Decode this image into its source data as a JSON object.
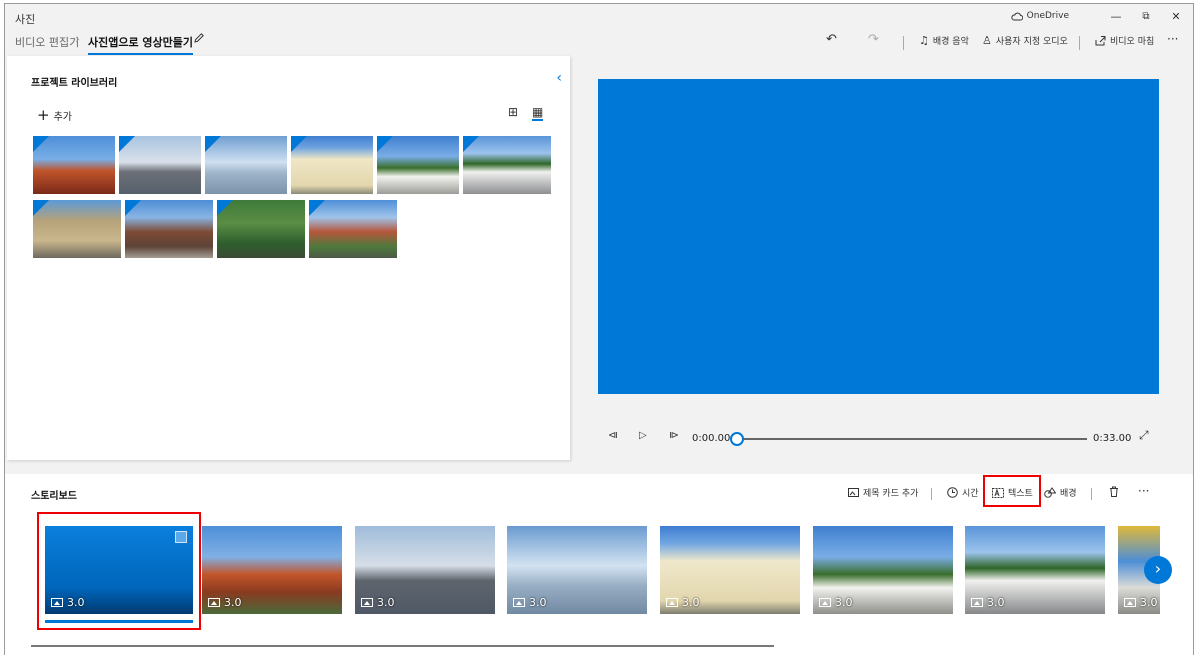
{
  "titlebar": {
    "app_title": "사진",
    "onedrive_label": "OneDrive",
    "minimize": "—",
    "maximize": "⧉",
    "close": "✕"
  },
  "breadcrumb": {
    "prev": "비디오 편집기",
    "current": "사진앱으로 영상만들기"
  },
  "toolbar": {
    "undo": "↶",
    "redo": "↷",
    "bg_music": "배경 음악",
    "custom_audio": "사용자 지정 오디오",
    "finish_video": "비디오 마침",
    "more": "···"
  },
  "library": {
    "title": "프로젝트 라이브러리",
    "add_label": "추가",
    "thumbnails": [
      {
        "name": "temple-roof-dragon"
      },
      {
        "name": "jetty-sunset"
      },
      {
        "name": "sea-clouds"
      },
      {
        "name": "colonial-building-1"
      },
      {
        "name": "colonial-building-2"
      },
      {
        "name": "city-hall"
      },
      {
        "name": "hindu-temple"
      },
      {
        "name": "chinese-clan-house"
      },
      {
        "name": "hillside-forest"
      },
      {
        "name": "temple-roof-trees"
      }
    ]
  },
  "preview": {
    "color": "#0078d7"
  },
  "playback": {
    "current_time": "0:00.00",
    "total_time": "0:33.00",
    "progress": 0.0
  },
  "storyboard": {
    "title": "스토리보드",
    "tools": {
      "title_card": "제목 카드 추가",
      "duration": "시간",
      "text": "텍스트",
      "background": "배경"
    },
    "clips": [
      {
        "duration": "3.0",
        "kind": "title-card"
      },
      {
        "duration": "3.0",
        "kind": "temple-roof-dragon"
      },
      {
        "duration": "3.0",
        "kind": "jetty-sunset"
      },
      {
        "duration": "3.0",
        "kind": "sea-clouds"
      },
      {
        "duration": "3.0",
        "kind": "colonial-building-1"
      },
      {
        "duration": "3.0",
        "kind": "colonial-building-2"
      },
      {
        "duration": "3.0",
        "kind": "city-hall"
      },
      {
        "duration": "3.0",
        "kind": "partial"
      }
    ]
  },
  "colors": {
    "accent": "#0078d7",
    "highlight": "#e00000"
  }
}
